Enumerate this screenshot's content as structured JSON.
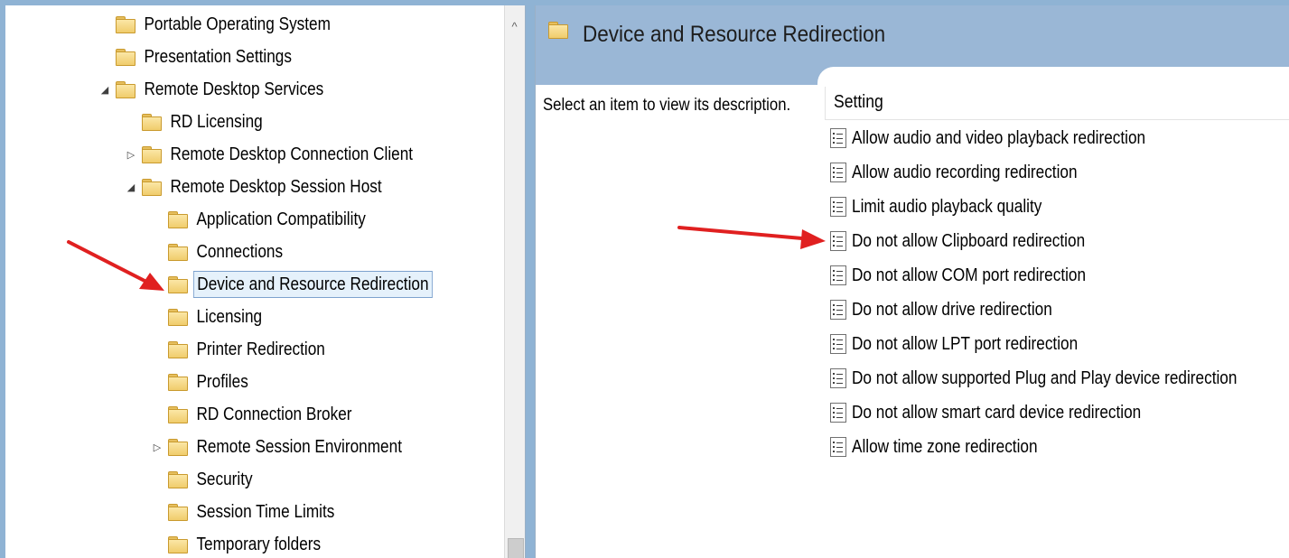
{
  "tree": {
    "items": [
      {
        "label": "Portable Operating System",
        "expander": ""
      },
      {
        "label": "Presentation Settings",
        "expander": ""
      },
      {
        "label": "Remote Desktop Services",
        "expander": "◢"
      },
      {
        "label": "RD Licensing",
        "expander": ""
      },
      {
        "label": "Remote Desktop Connection Client",
        "expander": "▷"
      },
      {
        "label": "Remote Desktop Session Host",
        "expander": "◢"
      },
      {
        "label": "Application Compatibility",
        "expander": ""
      },
      {
        "label": "Connections",
        "expander": ""
      },
      {
        "label": "Device and Resource Redirection",
        "expander": "",
        "selected": true
      },
      {
        "label": "Licensing",
        "expander": ""
      },
      {
        "label": "Printer Redirection",
        "expander": ""
      },
      {
        "label": "Profiles",
        "expander": ""
      },
      {
        "label": "RD Connection Broker",
        "expander": ""
      },
      {
        "label": "Remote Session Environment",
        "expander": "▷"
      },
      {
        "label": "Security",
        "expander": ""
      },
      {
        "label": "Session Time Limits",
        "expander": ""
      },
      {
        "label": "Temporary folders",
        "expander": ""
      }
    ],
    "scroll_up_glyph": "^"
  },
  "detail": {
    "title": "Device and Resource Redirection",
    "description": "Select an item to view its description.",
    "column_header": "Setting",
    "settings": [
      "Allow audio and video playback redirection",
      "Allow audio recording redirection",
      "Limit audio playback quality",
      "Do not allow Clipboard redirection",
      "Do not allow COM port redirection",
      "Do not allow drive redirection",
      "Do not allow LPT port redirection",
      "Do not allow supported Plug and Play device redirection",
      "Do not allow smart card device redirection",
      "Allow time zone redirection"
    ]
  },
  "colors": {
    "accent_arrow": "#e02020",
    "header_bg": "#9ab7d6",
    "selection_border": "#7da2ce"
  }
}
